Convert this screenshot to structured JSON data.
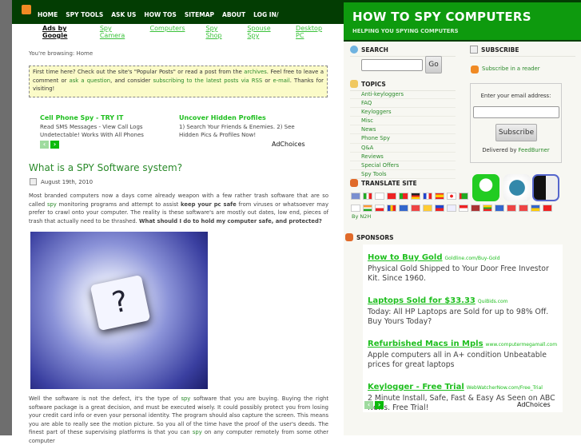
{
  "nav": {
    "items": [
      "HOME",
      "SPY TOOLS",
      "ASK US",
      "HOW TOS",
      "SITEMAP",
      "ABOUT",
      "LOG IN/"
    ]
  },
  "adlinks": {
    "label": "Ads by Google",
    "links": [
      "Spy Camera",
      "Computers",
      "Spy Shop",
      "Spouse Spy",
      "Desktop PC"
    ]
  },
  "breadcrumb": "You're browsing: Home",
  "notice": {
    "p1": "First time here? Check out the site's \"Popular Posts\" or read a post from the ",
    "archives": "archives",
    "p2": ". Feel free to leave a comment or ",
    "ask": "ask a question",
    "p3": ", and consider ",
    "subscribe": "subscribing to the latest posts via RSS",
    "p4": " or ",
    "email": "e-mail",
    "p5": ". Thanks for visiting!"
  },
  "ads_top": [
    {
      "title": "Cell Phone Spy - TRY IT",
      "desc": "Read SMS Messages - View Call Logs Undetectable! Works With All Phones"
    },
    {
      "title": "Uncover Hidden Profiles",
      "desc": "1) Search Your Friends & Enemies. 2) See Hidden Pics & Profiles Now!"
    }
  ],
  "adchoices": "AdChoices",
  "post": {
    "title": "What is a SPY Software system?",
    "date": "August 19th, 2010",
    "p1a": "Most branded computers now a days come already weapon with a few rather trash software that are so called ",
    "spy": "spy",
    "p1b": " monitoring programs and attempt to assist ",
    "p1bold": "keep your pc safe",
    "p1c": " from viruses or whatsoever may prefer to crawl onto your computer. The reality is these software's are mostly out dates, low end, pieces of trash that actually need to be thrashed. ",
    "p1bold2": "What should I do to hold my computer safe, and protected?",
    "p2a": "Well the software is not the defect, it's the type of ",
    "p2b": " software that you are buying. Buying the right software package is a great decision, and must be executed wisely. It could possibly protect you from losing your credit card info or even your personal identity. The program should also capture the screen. This means you are able to really see the motion picture. So you all of the time have the proof of the user's deeds. The finest part of these supervising platforms is that you can ",
    "p2c": " on any computer remotely from some other computer"
  },
  "site": {
    "title": "HOW TO SPY COMPUTERS",
    "tagline": "HELPING YOU SPYING COMPUTERS"
  },
  "search": {
    "heading": "SEARCH",
    "value": "",
    "go": "Go"
  },
  "topics": {
    "heading": "TOPICS",
    "items": [
      "Anti-keyloggers",
      "FAQ",
      "Keyloggers",
      "Misc",
      "News",
      "Phone Spy",
      "Q&A",
      "Reviews",
      "Special Offers",
      "Spy Tools"
    ]
  },
  "subscribe": {
    "heading": "SUBSCRIBE",
    "reader": "Subscribe in a reader",
    "email_label": "Enter your email address:",
    "email_value": "",
    "button": "Subscribe",
    "delivered": "Delivered by ",
    "feedburner": "FeedBurner"
  },
  "translate": {
    "heading": "TRANSLATE SITE",
    "by": "By N2H"
  },
  "sponsors": {
    "heading": "SPONSORS",
    "ads": [
      {
        "title": "How to Buy Gold",
        "url": "Goldline.com/Buy-Gold",
        "desc": "Physical Gold Shipped to Your Door Free Investor Kit. Since 1960."
      },
      {
        "title": "Laptops Sold for $33.33",
        "url": "QuiBids.com",
        "desc": "Today: All HP Laptops are Sold for up to 98% Off. Buy Yours Today?"
      },
      {
        "title": "Refurbished Macs in Mpls",
        "url": "www.computermegamall.com",
        "desc": "Apple computers all in A+ condition Unbeatable prices for great laptops"
      },
      {
        "title": "Keylogger - Free Trial",
        "url": "WebWatcherNow.com/Free_Trial",
        "desc": "2 Minute Install, Safe, Fast & Easy As Seen on ABC News. Free Trial!"
      }
    ]
  },
  "colors": {
    "nav": "#033d03",
    "header": "#0e9a0e",
    "link": "#2a8a2a",
    "ad_title": "#1fbf1f"
  }
}
